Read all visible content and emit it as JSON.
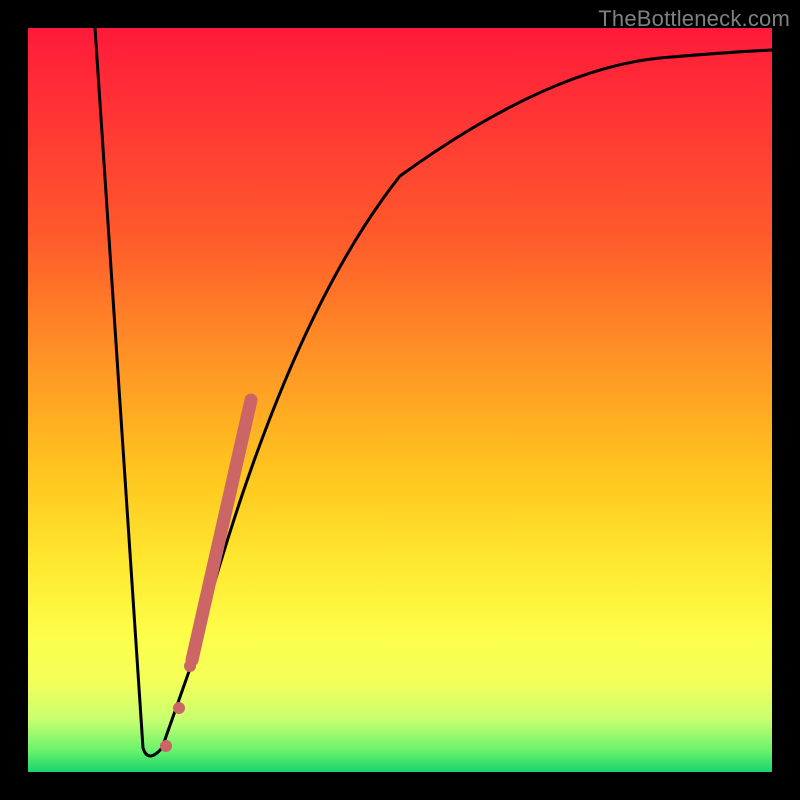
{
  "watermark": "TheBottleneck.com",
  "chart_data": {
    "type": "line",
    "title": "",
    "xlabel": "",
    "ylabel": "",
    "xlim": [
      0,
      100
    ],
    "ylim": [
      0,
      100
    ],
    "series": [
      {
        "name": "bottleneck-curve",
        "color": "#000000",
        "x": [
          9,
          15.5,
          18,
          34,
          50,
          70,
          85,
          100
        ],
        "y": [
          100,
          2,
          2,
          60,
          80,
          90,
          94,
          96
        ]
      },
      {
        "name": "highlight-segment",
        "color": "#cc6666",
        "points": [
          {
            "x": 18.5,
            "y": 3,
            "r": 5
          },
          {
            "x": 20.5,
            "y": 8,
            "r": 5
          },
          {
            "x": 22.0,
            "y": 15,
            "r": 5
          }
        ],
        "band": {
          "x0": 22.0,
          "y0": 15,
          "x1": 30.0,
          "y1": 50,
          "width": 12
        }
      }
    ],
    "background_gradient": {
      "top": "#ff1a3a",
      "mid": "#ffe830",
      "bottom": "#19d46a"
    }
  }
}
